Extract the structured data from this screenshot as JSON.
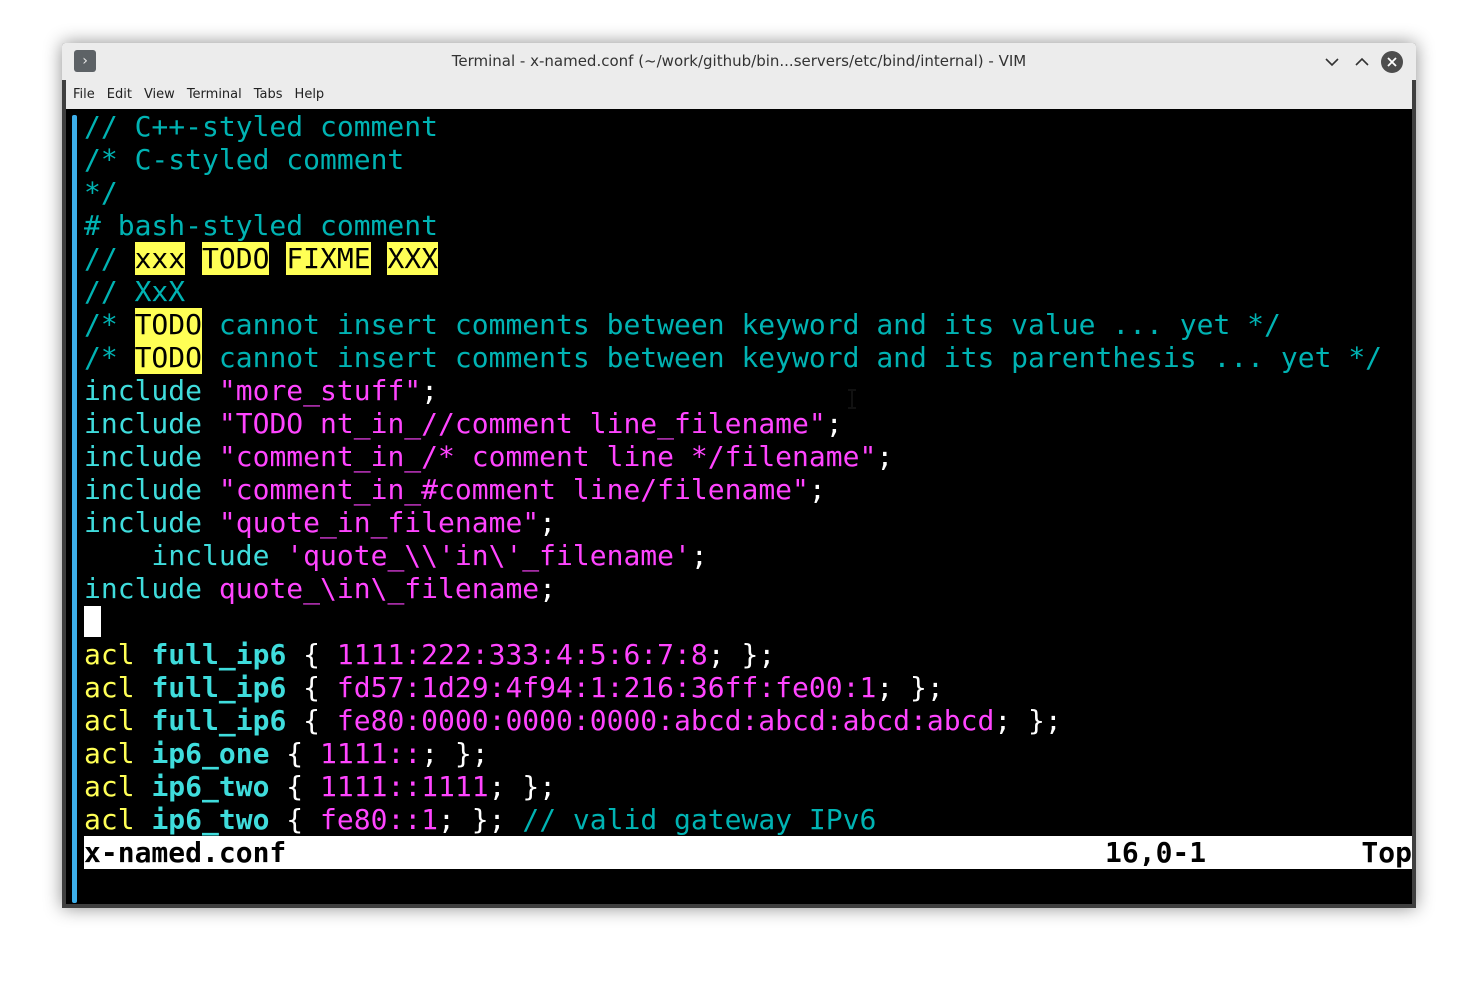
{
  "window": {
    "title": "Terminal - x-named.conf (~/work/github/bin...servers/etc/bind/internal) - VIM",
    "app_icon": "terminal-prompt-icon",
    "buttons": {
      "minimize": "chevron-down-icon",
      "maximize": "chevron-up-icon",
      "close": "close-icon"
    }
  },
  "menubar": {
    "items": [
      "File",
      "Edit",
      "View",
      "Terminal",
      "Tabs",
      "Help"
    ]
  },
  "colors": {
    "comment": "#00b3b3",
    "keyword": "#3fdcdc",
    "string": "#ff45ff",
    "acl": "#ffff55",
    "todo_bg": "#ffff55",
    "background": "#000000",
    "accent": "#3daee9"
  },
  "editor": {
    "lines": [
      [
        {
          "t": "// C++-styled comment",
          "c": "c-com"
        }
      ],
      [
        {
          "t": "/* C-styled comment",
          "c": "c-com"
        }
      ],
      [
        {
          "t": "*/",
          "c": "c-com"
        }
      ],
      [
        {
          "t": "# bash-styled comment",
          "c": "c-com"
        }
      ],
      [
        {
          "t": "// ",
          "c": "c-com"
        },
        {
          "t": "xxx",
          "c": "todo"
        },
        {
          "t": " ",
          "c": "c-com"
        },
        {
          "t": "TODO",
          "c": "todo"
        },
        {
          "t": " ",
          "c": "c-com"
        },
        {
          "t": "FIXME",
          "c": "todo"
        },
        {
          "t": " ",
          "c": "c-com"
        },
        {
          "t": "XXX",
          "c": "todo"
        }
      ],
      [
        {
          "t": "// XxX",
          "c": "c-com"
        }
      ],
      [
        {
          "t": "/* ",
          "c": "c-com"
        },
        {
          "t": "TODO",
          "c": "todo"
        },
        {
          "t": " cannot insert comments between keyword and its value ... yet */",
          "c": "c-com"
        }
      ],
      [
        {
          "t": "/* ",
          "c": "c-com"
        },
        {
          "t": "TODO",
          "c": "todo"
        },
        {
          "t": " cannot insert comments between keyword and its parenthesis ... yet */",
          "c": "c-com"
        }
      ],
      [
        {
          "t": "include",
          "c": "c-kw"
        },
        {
          "t": " ",
          "c": "c-wht"
        },
        {
          "t": "\"more_stuff\"",
          "c": "c-str"
        },
        {
          "t": ";",
          "c": "c-wht"
        }
      ],
      [
        {
          "t": "include",
          "c": "c-kw"
        },
        {
          "t": " ",
          "c": "c-wht"
        },
        {
          "t": "\"TODO nt_in_//comment line_filename\"",
          "c": "c-str"
        },
        {
          "t": ";",
          "c": "c-wht"
        }
      ],
      [
        {
          "t": "include",
          "c": "c-kw"
        },
        {
          "t": " ",
          "c": "c-wht"
        },
        {
          "t": "\"comment_in_/* comment line */filename\"",
          "c": "c-str"
        },
        {
          "t": ";",
          "c": "c-wht"
        }
      ],
      [
        {
          "t": "include",
          "c": "c-kw"
        },
        {
          "t": " ",
          "c": "c-wht"
        },
        {
          "t": "\"comment_in_#comment line/filename\"",
          "c": "c-str"
        },
        {
          "t": ";",
          "c": "c-wht"
        }
      ],
      [
        {
          "t": "include",
          "c": "c-kw"
        },
        {
          "t": " ",
          "c": "c-wht"
        },
        {
          "t": "\"quote_in_filename\"",
          "c": "c-str"
        },
        {
          "t": ";",
          "c": "c-wht"
        }
      ],
      [
        {
          "t": "    include",
          "c": "c-kw"
        },
        {
          "t": " ",
          "c": "c-wht"
        },
        {
          "t": "'quote_\\\\'in\\'_filename'",
          "c": "c-str"
        },
        {
          "t": ";",
          "c": "c-wht"
        }
      ],
      [
        {
          "t": "include",
          "c": "c-kw"
        },
        {
          "t": " ",
          "c": "c-wht"
        },
        {
          "t": "quote_\\in\\_filename",
          "c": "c-str"
        },
        {
          "t": ";",
          "c": "c-wht"
        }
      ],
      [
        {
          "t": "",
          "c": "cursor"
        }
      ],
      [
        {
          "t": "acl",
          "c": "c-acl"
        },
        {
          "t": " ",
          "c": "c-wht"
        },
        {
          "t": "full_ip6",
          "c": "c-name"
        },
        {
          "t": " { ",
          "c": "c-wht"
        },
        {
          "t": "1111:222:333:4:5:6:7:8",
          "c": "c-str"
        },
        {
          "t": "; };",
          "c": "c-wht"
        }
      ],
      [
        {
          "t": "acl",
          "c": "c-acl"
        },
        {
          "t": " ",
          "c": "c-wht"
        },
        {
          "t": "full_ip6",
          "c": "c-name"
        },
        {
          "t": " { ",
          "c": "c-wht"
        },
        {
          "t": "fd57:1d29:4f94:1:216:36ff:fe00:1",
          "c": "c-str"
        },
        {
          "t": "; };",
          "c": "c-wht"
        }
      ],
      [
        {
          "t": "acl",
          "c": "c-acl"
        },
        {
          "t": " ",
          "c": "c-wht"
        },
        {
          "t": "full_ip6",
          "c": "c-name"
        },
        {
          "t": " { ",
          "c": "c-wht"
        },
        {
          "t": "fe80:0000:0000:0000:abcd:abcd:abcd:abcd",
          "c": "c-str"
        },
        {
          "t": "; };",
          "c": "c-wht"
        }
      ],
      [
        {
          "t": "acl",
          "c": "c-acl"
        },
        {
          "t": " ",
          "c": "c-wht"
        },
        {
          "t": "ip6_one",
          "c": "c-name"
        },
        {
          "t": " { ",
          "c": "c-wht"
        },
        {
          "t": "1111::",
          "c": "c-str"
        },
        {
          "t": "; };",
          "c": "c-wht"
        }
      ],
      [
        {
          "t": "acl",
          "c": "c-acl"
        },
        {
          "t": " ",
          "c": "c-wht"
        },
        {
          "t": "ip6_two",
          "c": "c-name"
        },
        {
          "t": " { ",
          "c": "c-wht"
        },
        {
          "t": "1111::1111",
          "c": "c-str"
        },
        {
          "t": "; };",
          "c": "c-wht"
        }
      ],
      [
        {
          "t": "acl",
          "c": "c-acl"
        },
        {
          "t": " ",
          "c": "c-wht"
        },
        {
          "t": "ip6_two",
          "c": "c-name"
        },
        {
          "t": " { ",
          "c": "c-wht"
        },
        {
          "t": "fe80::1",
          "c": "c-str"
        },
        {
          "t": "; }; ",
          "c": "c-wht"
        },
        {
          "t": "// valid gateway IPv6",
          "c": "c-com"
        }
      ]
    ]
  },
  "statusline": {
    "filename": "x-named.conf",
    "position": "16,0-1",
    "scroll": "Top"
  }
}
